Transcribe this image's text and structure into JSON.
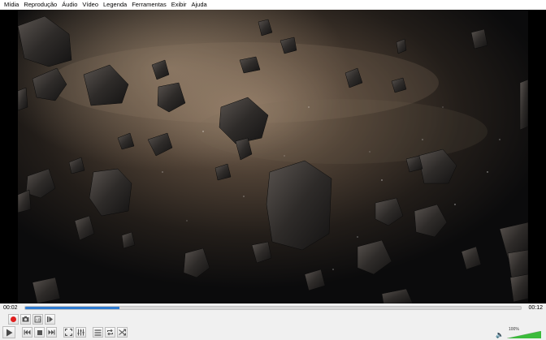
{
  "menu": [
    "Mídia",
    "Reprodução",
    "Áudio",
    "Vídeo",
    "Legenda",
    "Ferramentas",
    "Exibir",
    "Ajuda"
  ],
  "player": {
    "elapsed": "00:02",
    "total": "00:12",
    "progress": 0.19,
    "volume_label": "100%",
    "volume": 1.0
  },
  "icons": {
    "record": "record-icon",
    "snapshot": "camera-icon",
    "loop_ab": "loop-ab-icon",
    "frame_step": "frame-step-icon",
    "play": "play-icon",
    "previous": "previous-icon",
    "stop": "stop-icon",
    "next": "next-icon",
    "fullscreen": "fullscreen-icon",
    "extended": "extended-settings-icon",
    "playlist": "playlist-icon",
    "loop": "loop-icon",
    "shuffle": "shuffle-icon",
    "volume": "speaker-icon"
  },
  "colors": {
    "accent": "#2e7bd0",
    "record": "#e02020",
    "volume_fill": "#3bbb3b"
  }
}
